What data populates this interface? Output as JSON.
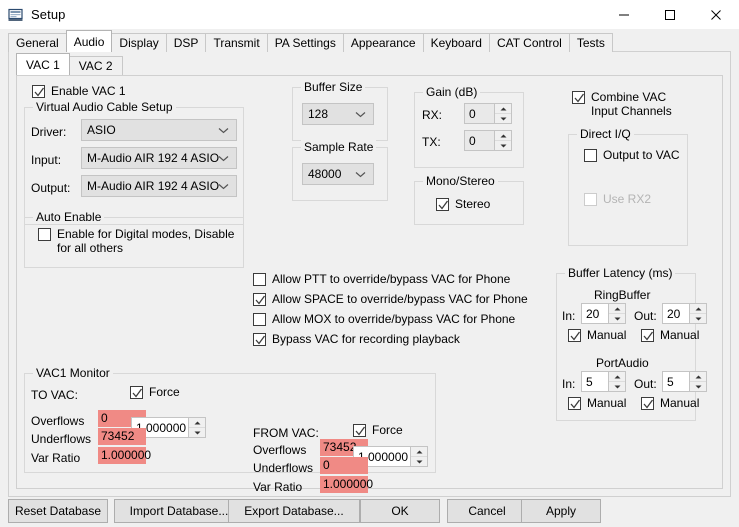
{
  "window": {
    "title": "Setup",
    "icon": "app-setup-icon",
    "minimize": "—",
    "maximize": "☐",
    "close": "✕"
  },
  "tabs": {
    "items": [
      {
        "label": "General",
        "active": false
      },
      {
        "label": "Audio",
        "active": true
      },
      {
        "label": "Display",
        "active": false
      },
      {
        "label": "DSP",
        "active": false
      },
      {
        "label": "Transmit",
        "active": false
      },
      {
        "label": "PA Settings",
        "active": false
      },
      {
        "label": "Appearance",
        "active": false
      },
      {
        "label": "Keyboard",
        "active": false
      },
      {
        "label": "CAT Control",
        "active": false
      },
      {
        "label": "Tests",
        "active": false
      }
    ]
  },
  "subtabs": {
    "items": [
      {
        "label": "VAC 1",
        "active": true
      },
      {
        "label": "VAC 2",
        "active": false
      }
    ]
  },
  "enable_vac": {
    "label": "Enable VAC 1",
    "checked": true
  },
  "vac_setup": {
    "group_label": "Virtual Audio Cable Setup",
    "driver_label": "Driver:",
    "driver_value": "ASIO",
    "input_label": "Input:",
    "input_value": "M-Audio AIR 192 4 ASIO",
    "output_label": "Output:",
    "output_value": "M-Audio AIR 192 4 ASIO"
  },
  "auto_enable": {
    "group_label": "Auto Enable",
    "checkbox_label": "Enable for Digital modes, Disable\nfor all others",
    "checked": false
  },
  "buffer_size": {
    "group_label": "Buffer Size",
    "value": "128"
  },
  "sample_rate": {
    "group_label": "Sample Rate",
    "value": "48000"
  },
  "gain": {
    "group_label": "Gain (dB)",
    "rx_label": "RX:",
    "rx_value": "0",
    "tx_label": "TX:",
    "tx_value": "0"
  },
  "mono_stereo": {
    "group_label": "Mono/Stereo",
    "stereo_label": "Stereo",
    "stereo_checked": true
  },
  "combine_vac": {
    "label": "Combine VAC\nInput Channels",
    "checked": true
  },
  "direct_iq": {
    "group_label": "Direct I/Q",
    "output_to_vac_label": "Output to VAC",
    "output_to_vac_checked": false,
    "use_rx2_label": "Use RX2",
    "use_rx2_checked": false,
    "use_rx2_disabled": true
  },
  "override_options": [
    {
      "label": "Allow PTT to override/bypass VAC for Phone",
      "checked": false
    },
    {
      "label": "Allow SPACE to override/bypass VAC for Phone",
      "checked": true
    },
    {
      "label": "Allow MOX to override/bypass VAC for Phone",
      "checked": false
    },
    {
      "label": "Bypass VAC for recording playback",
      "checked": true
    }
  ],
  "buffer_latency": {
    "group_label": "Buffer Latency (ms)",
    "ringbuffer_label": "RingBuffer",
    "rb_in_label": "In:",
    "rb_in_value": "20",
    "rb_out_label": "Out:",
    "rb_out_value": "20",
    "rb_in_manual_label": "Manual",
    "rb_in_manual_checked": true,
    "rb_out_manual_label": "Manual",
    "rb_out_manual_checked": true,
    "portaudio_label": "PortAudio",
    "pa_in_label": "In:",
    "pa_in_value": "5",
    "pa_out_label": "Out:",
    "pa_out_value": "5",
    "pa_in_manual_label": "Manual",
    "pa_in_manual_checked": true,
    "pa_out_manual_label": "Manual",
    "pa_out_manual_checked": true
  },
  "vac1_monitor": {
    "group_label": "VAC1 Monitor",
    "to_vac": {
      "title": "TO VAC:",
      "force_label": "Force",
      "force_checked": true,
      "ratio_value": "1.000000",
      "overflows_label": "Overflows",
      "overflows_value": "0",
      "underflows_label": "Underflows",
      "underflows_value": "73452",
      "var_ratio_label": "Var Ratio",
      "var_ratio_value": "1.000000"
    },
    "from_vac": {
      "title": "FROM VAC:",
      "force_label": "Force",
      "force_checked": true,
      "ratio_value": "1.000000",
      "overflows_label": "Overflows",
      "overflows_value": "73452",
      "underflows_label": "Underflows",
      "underflows_value": "0",
      "var_ratio_label": "Var Ratio",
      "var_ratio_value": "1.000000"
    }
  },
  "footer": {
    "reset_database": "Reset Database",
    "import_database": "Import Database...",
    "export_database": "Export Database...",
    "ok": "OK",
    "cancel": "Cancel",
    "apply": "Apply"
  },
  "colors": {
    "highlight": "#f08a85",
    "window_bg": "#f0f0f0",
    "control_bg": "#e1e1e1",
    "titlebar_bg": "#ffffff"
  }
}
